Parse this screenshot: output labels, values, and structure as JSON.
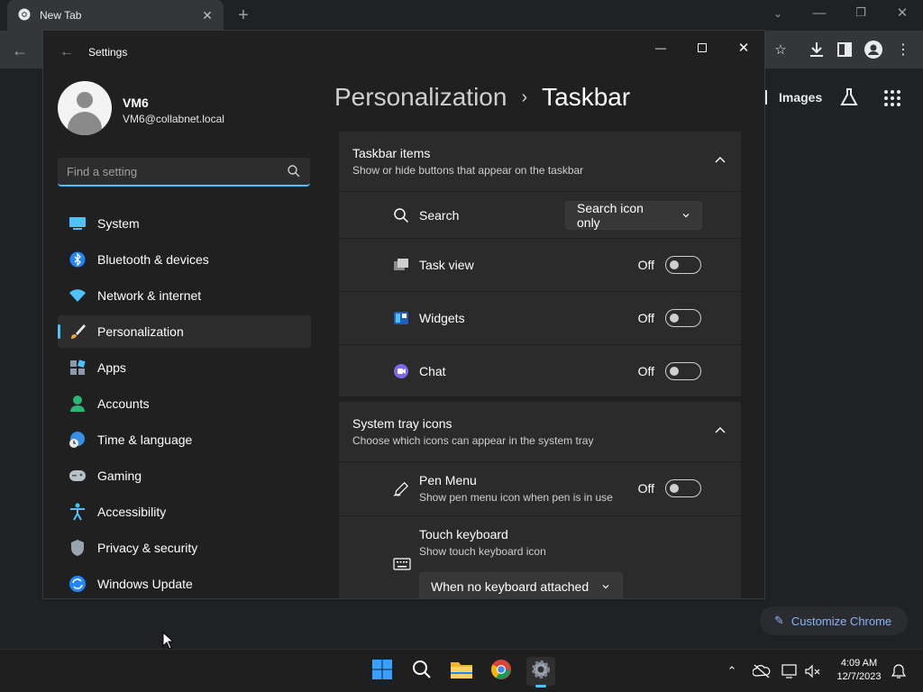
{
  "chrome": {
    "tab_title": "New Tab",
    "images_link": "Images",
    "customize_label": "Customize Chrome"
  },
  "settings": {
    "window_title": "Settings",
    "user": {
      "name": "VM6",
      "email": "VM6@collabnet.local"
    },
    "search": {
      "placeholder": "Find a setting"
    },
    "nav": [
      {
        "label": "System",
        "icon": "system-icon"
      },
      {
        "label": "Bluetooth & devices",
        "icon": "bluetooth-icon"
      },
      {
        "label": "Network & internet",
        "icon": "wifi-icon"
      },
      {
        "label": "Personalization",
        "icon": "brush-icon",
        "selected": true
      },
      {
        "label": "Apps",
        "icon": "apps-icon"
      },
      {
        "label": "Accounts",
        "icon": "person-icon"
      },
      {
        "label": "Time & language",
        "icon": "globe-clock-icon"
      },
      {
        "label": "Gaming",
        "icon": "gamepad-icon"
      },
      {
        "label": "Accessibility",
        "icon": "accessibility-icon"
      },
      {
        "label": "Privacy & security",
        "icon": "shield-icon"
      },
      {
        "label": "Windows Update",
        "icon": "update-icon"
      }
    ],
    "breadcrumb": {
      "parent": "Personalization",
      "separator": "›",
      "current": "Taskbar"
    },
    "taskbar_items": {
      "title": "Taskbar items",
      "subtitle": "Show or hide buttons that appear on the taskbar",
      "search": {
        "label": "Search",
        "value": "Search icon only"
      },
      "task_view": {
        "label": "Task view",
        "state": "Off"
      },
      "widgets": {
        "label": "Widgets",
        "state": "Off"
      },
      "chat": {
        "label": "Chat",
        "state": "Off"
      }
    },
    "system_tray": {
      "title": "System tray icons",
      "subtitle": "Choose which icons can appear in the system tray",
      "pen_menu": {
        "label": "Pen Menu",
        "subtitle": "Show pen menu icon when pen is in use",
        "state": "Off"
      },
      "touch_keyboard": {
        "label": "Touch keyboard",
        "subtitle": "Show touch keyboard icon",
        "value": "When no keyboard attached"
      }
    }
  },
  "taskbar": {
    "time": "4:09 AM",
    "date": "12/7/2023"
  },
  "colors": {
    "accent": "#4cc2ff",
    "chrome_link": "#8ab4f8"
  }
}
